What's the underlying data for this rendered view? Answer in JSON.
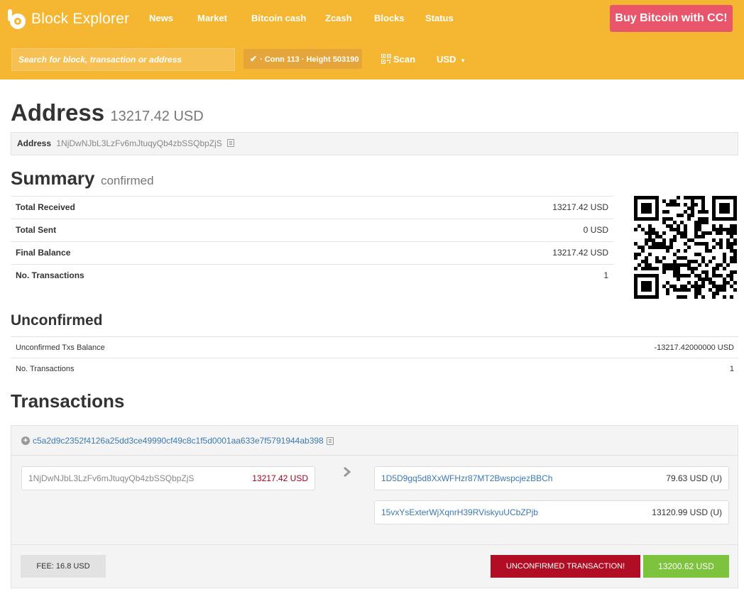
{
  "colors": {
    "header": "#f5b731",
    "buy_button": "#e9566b",
    "link": "#3a7ab4",
    "unconfirmed": "#b10e25",
    "confirmed_total": "#7ec33d",
    "input_amount": "#a3001b"
  },
  "header": {
    "logo_text": "Block Explorer",
    "logo_icon": "block-explorer-logo",
    "nav": [
      "News",
      "Market",
      "Bitcoin cash",
      "Zcash",
      "Blocks",
      "Status"
    ],
    "buy_label": "Buy Bitcoin with CC!",
    "search_placeholder": "Search for block, transaction or address",
    "conn_icon": "check-icon",
    "conn_text": "· Conn 113 · Height 503190",
    "scan_icon": "qr-scan-icon",
    "scan_label": "Scan",
    "currency": "USD"
  },
  "address": {
    "title": "Address",
    "balance": "13217.42 USD",
    "label": "Address",
    "value": "1NjDwNJbL3LzFv6mJtuqyQb4zbSSQbpZjS"
  },
  "summary": {
    "title": "Summary",
    "subtitle": "confirmed",
    "rows": [
      {
        "label": "Total Received",
        "value": "13217.42 USD"
      },
      {
        "label": "Total Sent",
        "value": "0 USD"
      },
      {
        "label": "Final Balance",
        "value": "13217.42 USD"
      },
      {
        "label": "No. Transactions",
        "value": "1"
      }
    ]
  },
  "unconfirmed": {
    "title": "Unconfirmed",
    "rows": [
      {
        "label": "Unconfirmed Txs Balance",
        "value": "-13217.42000000 USD"
      },
      {
        "label": "No. Transactions",
        "value": "1"
      }
    ]
  },
  "transactions": {
    "title": "Transactions",
    "items": [
      {
        "txid": "c5a2d9c2352f4126a25dd3ce49990cf49c8c1f5d0001aa633e7f5791944ab398",
        "inputs": [
          {
            "address": "1NjDwNJbL3LzFv6mJtuqyQb4zbSSQbpZjS",
            "amount": "13217.42 USD"
          }
        ],
        "outputs": [
          {
            "address": "1D5D9gq5d8XxWFHzr87MT2BwspcjezBBCh",
            "amount": "79.63 USD (U)"
          },
          {
            "address": "15vxYsExterWjXqnrH39RViskyuUCbZPjb",
            "amount": "13120.99 USD (U)"
          }
        ],
        "fee": "FEE: 16.8 USD",
        "status": "UNCONFIRMED TRANSACTION!",
        "total": "13200.62 USD"
      }
    ]
  }
}
